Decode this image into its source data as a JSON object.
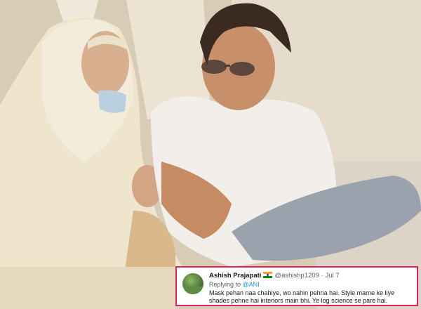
{
  "tweet": {
    "name": "Ashish Prajapati",
    "flag_icon": "india-flag-icon",
    "handle": "@ashishp1209",
    "separator": "·",
    "date": "Jul 7",
    "replying_prefix": "Replying to",
    "replying_to": "@ANI",
    "text": "Mask pehan naa chahiye, wo nahin pehna hai. Style marne ke liye shades pehne hai interiors main bhi. Ye log science se pare hai."
  },
  "colors": {
    "card_border": "#e0245e",
    "mention": "#1b95e0",
    "name": "#14171a",
    "secondary_text": "#536471"
  }
}
